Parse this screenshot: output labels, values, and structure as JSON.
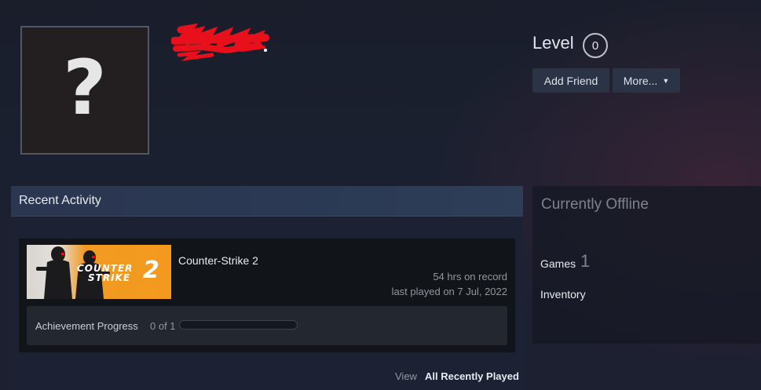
{
  "profile": {
    "avatar_placeholder": "?",
    "level_label": "Level",
    "level_value": "0",
    "add_friend_label": "Add Friend",
    "more_label": "More...",
    "more_caret": "▼"
  },
  "activity": {
    "header": "Recent Activity",
    "game": {
      "title": "Counter-Strike 2",
      "hours": "54 hrs on record",
      "last_played": "last played on 7 Jul, 2022",
      "thumb_line1": "COUNTER",
      "thumb_line2": "STRIKE",
      "thumb_number": "2"
    },
    "achievement": {
      "label": "Achievement Progress",
      "count": "0 of 1",
      "progress_fraction": 0
    },
    "view_label": "View",
    "view_link": "All Recently Played"
  },
  "side": {
    "status": "Currently Offline",
    "games_label": "Games",
    "games_count": "1",
    "inventory_label": "Inventory"
  },
  "colors": {
    "accent_orange": "#f39a1e",
    "redaction": "#e8101a"
  }
}
